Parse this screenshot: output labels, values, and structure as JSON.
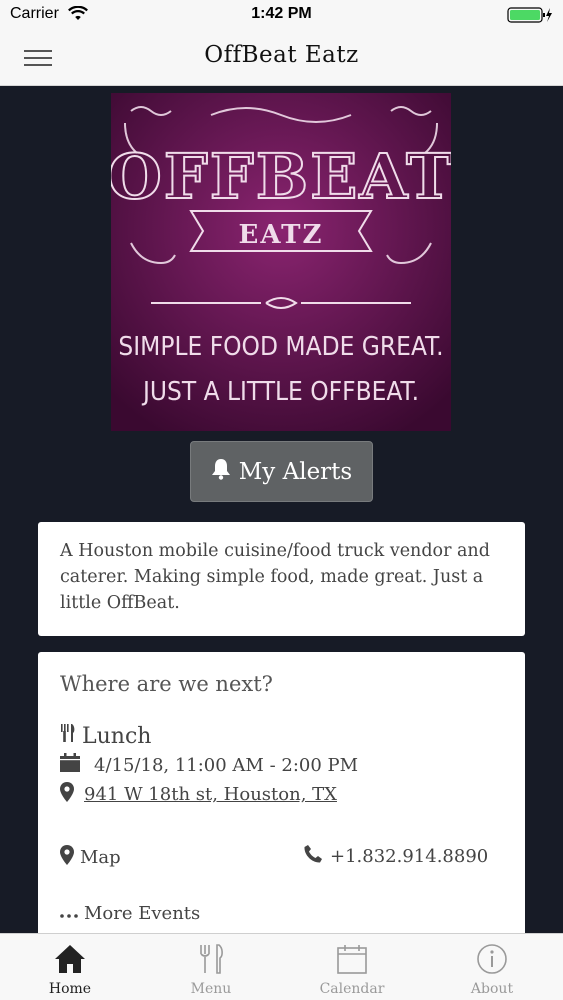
{
  "status_bar": {
    "carrier": "Carrier",
    "time": "1:42 PM"
  },
  "nav": {
    "title": "OffBeat Eatz",
    "menu_icon": "hamburger-icon"
  },
  "hero": {
    "logo_line1": "OFFBEAT",
    "logo_banner": "EATZ",
    "tagline1": "SIMPLE FOOD MADE GREAT.",
    "tagline2": "JUST A LITTLE OFFBEAT.",
    "colors": {
      "bg": "#4a0d3c",
      "glow": "#8a2470",
      "chalk": "#f0dcea"
    }
  },
  "alerts_button": {
    "label": "My Alerts",
    "icon": "bell-icon"
  },
  "description": "A Houston mobile cuisine/food truck vendor and caterer. Making simple food, made great. Just a little OffBeat.",
  "next_event": {
    "heading": "Where are we next?",
    "type": "Lunch",
    "datetime": "4/15/18, 11:00 AM - 2:00 PM",
    "address": "941 W 18th st, Houston, TX",
    "map_label": "Map",
    "phone": "+1.832.914.8890",
    "more_label": "More Events"
  },
  "tabs": [
    {
      "label": "Home",
      "icon": "home-icon",
      "active": true
    },
    {
      "label": "Menu",
      "icon": "fork-knife-icon",
      "active": false
    },
    {
      "label": "Calendar",
      "icon": "calendar-icon",
      "active": false
    },
    {
      "label": "About",
      "icon": "info-icon",
      "active": false
    }
  ]
}
